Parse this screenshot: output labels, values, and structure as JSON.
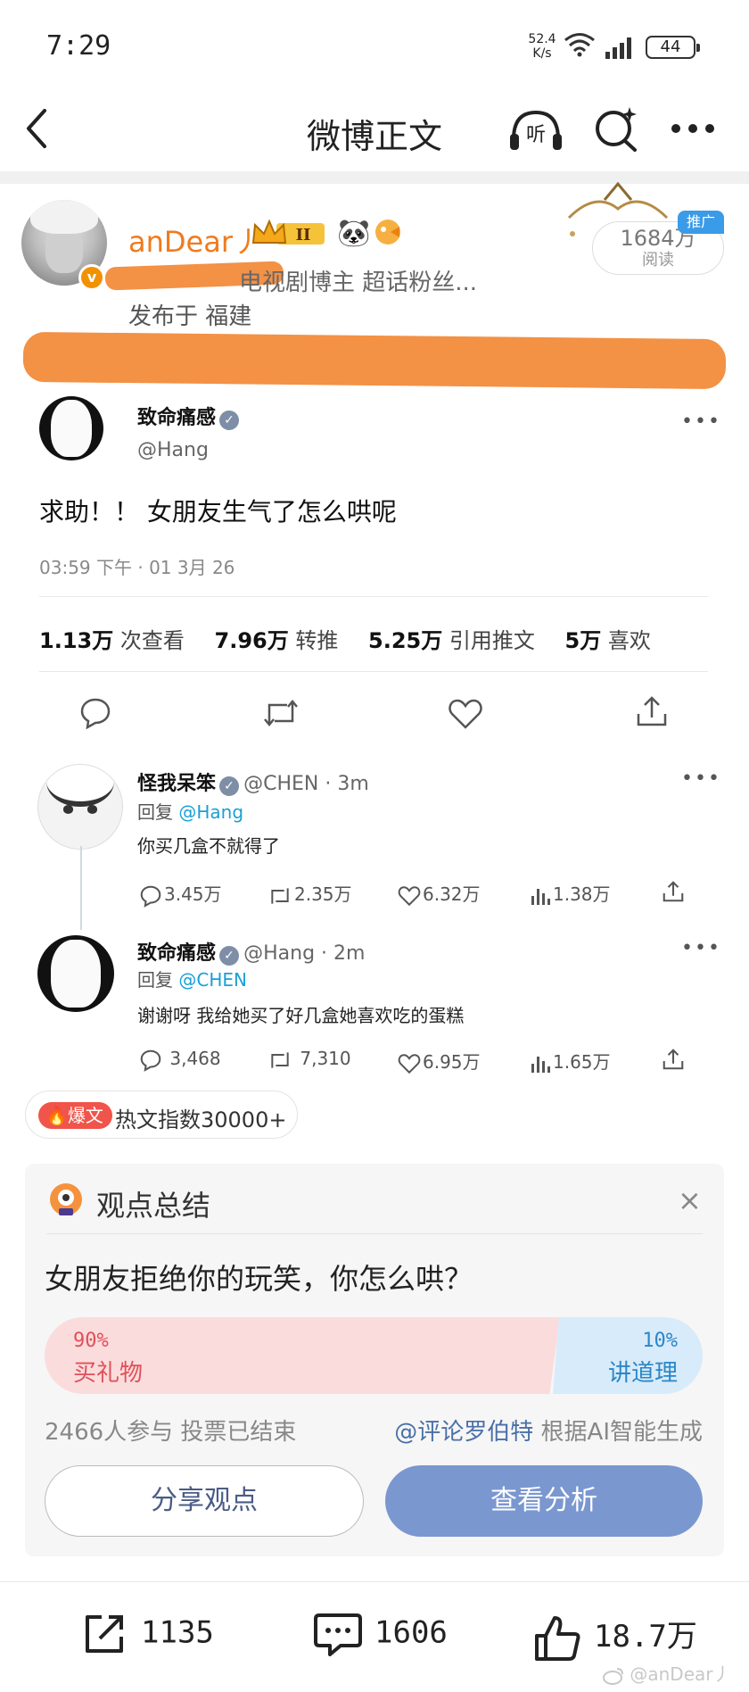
{
  "status_bar": {
    "time": "7:29",
    "net_speed_value": "52.4",
    "net_speed_unit": "K/s",
    "battery": "44"
  },
  "nav": {
    "title": "微博正文"
  },
  "post": {
    "author": {
      "name": "anDear丿",
      "meta": "电视剧博主 超话粉丝...",
      "publish_location": "发布于 福建",
      "badge_level": "II",
      "verified_mark": "v"
    },
    "reads": {
      "count": "1684万",
      "label": "阅读"
    },
    "promo_tag": "推广"
  },
  "tweet": {
    "author_name": "致命痛感",
    "handle": "@Hang",
    "text": "求助！！ 女朋友生气了怎么哄呢",
    "time": "03:59 下午 · 01 3月 26",
    "stats": [
      {
        "value": "1.13万",
        "label": "次查看"
      },
      {
        "value": "7.96万",
        "label": "转推"
      },
      {
        "value": "5.25万",
        "label": "引用推文"
      },
      {
        "value": "5万",
        "label": "喜欢"
      }
    ],
    "more": "•••"
  },
  "replies": [
    {
      "name": "怪我呆笨",
      "handle_time": "@CHEN · 3m",
      "reply_prefix": "回复",
      "reply_to": "@Hang",
      "text": "你买几盒不就得了",
      "comments": "3.45万",
      "retweets": "2.35万",
      "likes": "6.32万",
      "views": "1.38万"
    },
    {
      "name": "致命痛感",
      "handle_time": "@Hang · 2m",
      "reply_prefix": "回复",
      "reply_to": "@CHEN",
      "text": "谢谢呀 我给她买了好几盒她喜欢吃的蛋糕",
      "comments": "3,468",
      "retweets": "7,310",
      "likes": "6.95万",
      "views": "1.65万"
    }
  ],
  "hot": {
    "badge": "爆文",
    "text": "热文指数30000+"
  },
  "opinion": {
    "title": "观点总结",
    "close": "×",
    "question": "女朋友拒绝你的玩笑，你怎么哄？",
    "option_left": {
      "percent": "90%",
      "label": "买礼物",
      "fraction": 0.9
    },
    "option_right": {
      "percent": "10%",
      "label": "讲道理",
      "fraction": 0.1
    },
    "participants": "2466人参与  投票已结束",
    "ai_account": "@评论罗伯特",
    "ai_note": " 根据AI智能生成",
    "share_button": "分享观点",
    "analyze_button": "查看分析"
  },
  "bottom_bar": {
    "share_count": "1135",
    "comment_count": "1606",
    "like_count": "18.7万"
  },
  "watermark": "@anDear丿",
  "colors": {
    "author_orange": "#f07a1e",
    "redaction": "#f39145",
    "link_blue": "#1aa0d6",
    "analyze_button": "#7b97d0",
    "vote_left": "#fbdcdc",
    "vote_right": "#d8ebfa"
  },
  "icons": {
    "back": "chevron-left-icon",
    "listen": "headphones-icon",
    "search": "search-sparkle-icon",
    "more": "more-dots-icon"
  }
}
